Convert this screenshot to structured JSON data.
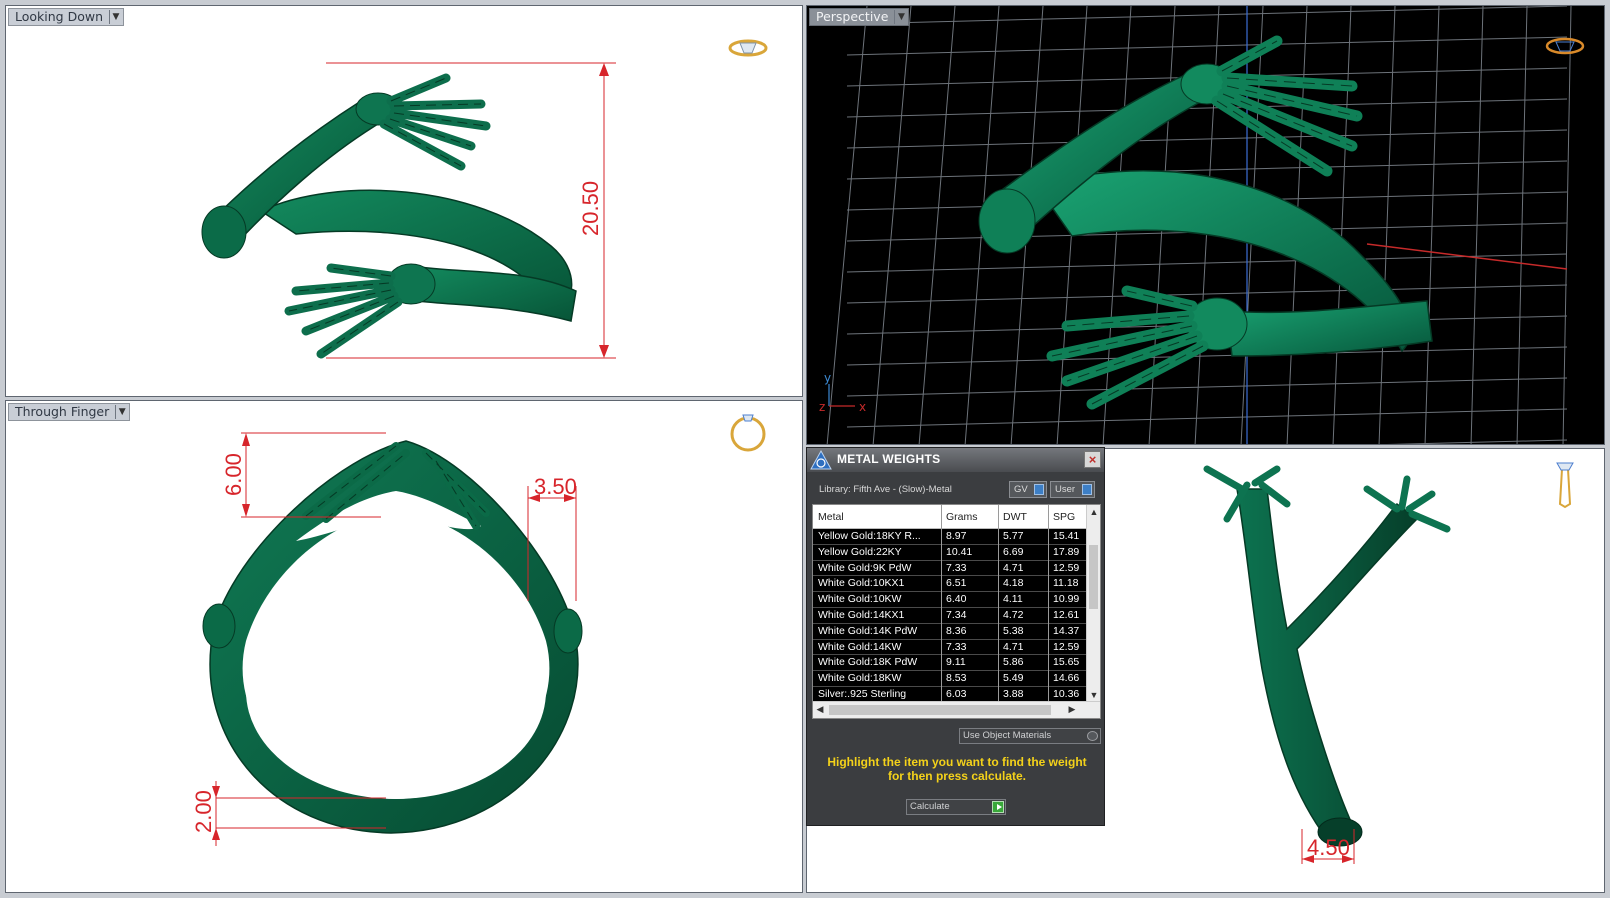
{
  "viewports": {
    "top_left": {
      "label": "Looking Down",
      "dimension": "20.50"
    },
    "top_right": {
      "label": "Perspective",
      "axis_y": "y",
      "axis_x": "x",
      "axis_z": "z"
    },
    "bottom_left": {
      "label": "Through Finger",
      "dim_top": "6.00",
      "dim_side": "3.50",
      "dim_bottom": "2.00"
    },
    "bottom_right": {
      "dimension": "4.50"
    }
  },
  "metal_weights": {
    "title": "METAL WEIGHTS",
    "close_label": "×",
    "library": "Library: Fifth Ave - (Slow)-Metal",
    "toggle_gv": "GV",
    "toggle_user": "User",
    "columns": [
      "Metal",
      "Grams",
      "DWT",
      "SPG"
    ],
    "rows": [
      [
        "Yellow Gold:18KY R...",
        "8.97",
        "5.77",
        "15.41"
      ],
      [
        "Yellow Gold:22KY",
        "10.41",
        "6.69",
        "17.89"
      ],
      [
        "White Gold:9K PdW",
        "7.33",
        "4.71",
        "12.59"
      ],
      [
        "White Gold:10KX1",
        "6.51",
        "4.18",
        "11.18"
      ],
      [
        "White Gold:10KW",
        "6.40",
        "4.11",
        "10.99"
      ],
      [
        "White Gold:14KX1",
        "7.34",
        "4.72",
        "12.61"
      ],
      [
        "White Gold:14K PdW",
        "8.36",
        "5.38",
        "14.37"
      ],
      [
        "White Gold:14KW",
        "7.33",
        "4.71",
        "12.59"
      ],
      [
        "White Gold:18K PdW",
        "9.11",
        "5.86",
        "15.65"
      ],
      [
        "White Gold:18KW",
        "8.53",
        "5.49",
        "14.66"
      ],
      [
        "Silver:.925 Sterling",
        "6.03",
        "3.88",
        "10.36"
      ]
    ],
    "use_object_materials": "Use Object Materials",
    "hint_line1": "Highlight the item you want to find the weight",
    "hint_line2": "for then press calculate.",
    "calculate_label": "Calculate"
  },
  "colors": {
    "model": "#0d6e4c",
    "model_dark": "#073e2a",
    "dimension": "#d7252b",
    "grid": "#6d737a",
    "hint": "#f4d21a"
  }
}
